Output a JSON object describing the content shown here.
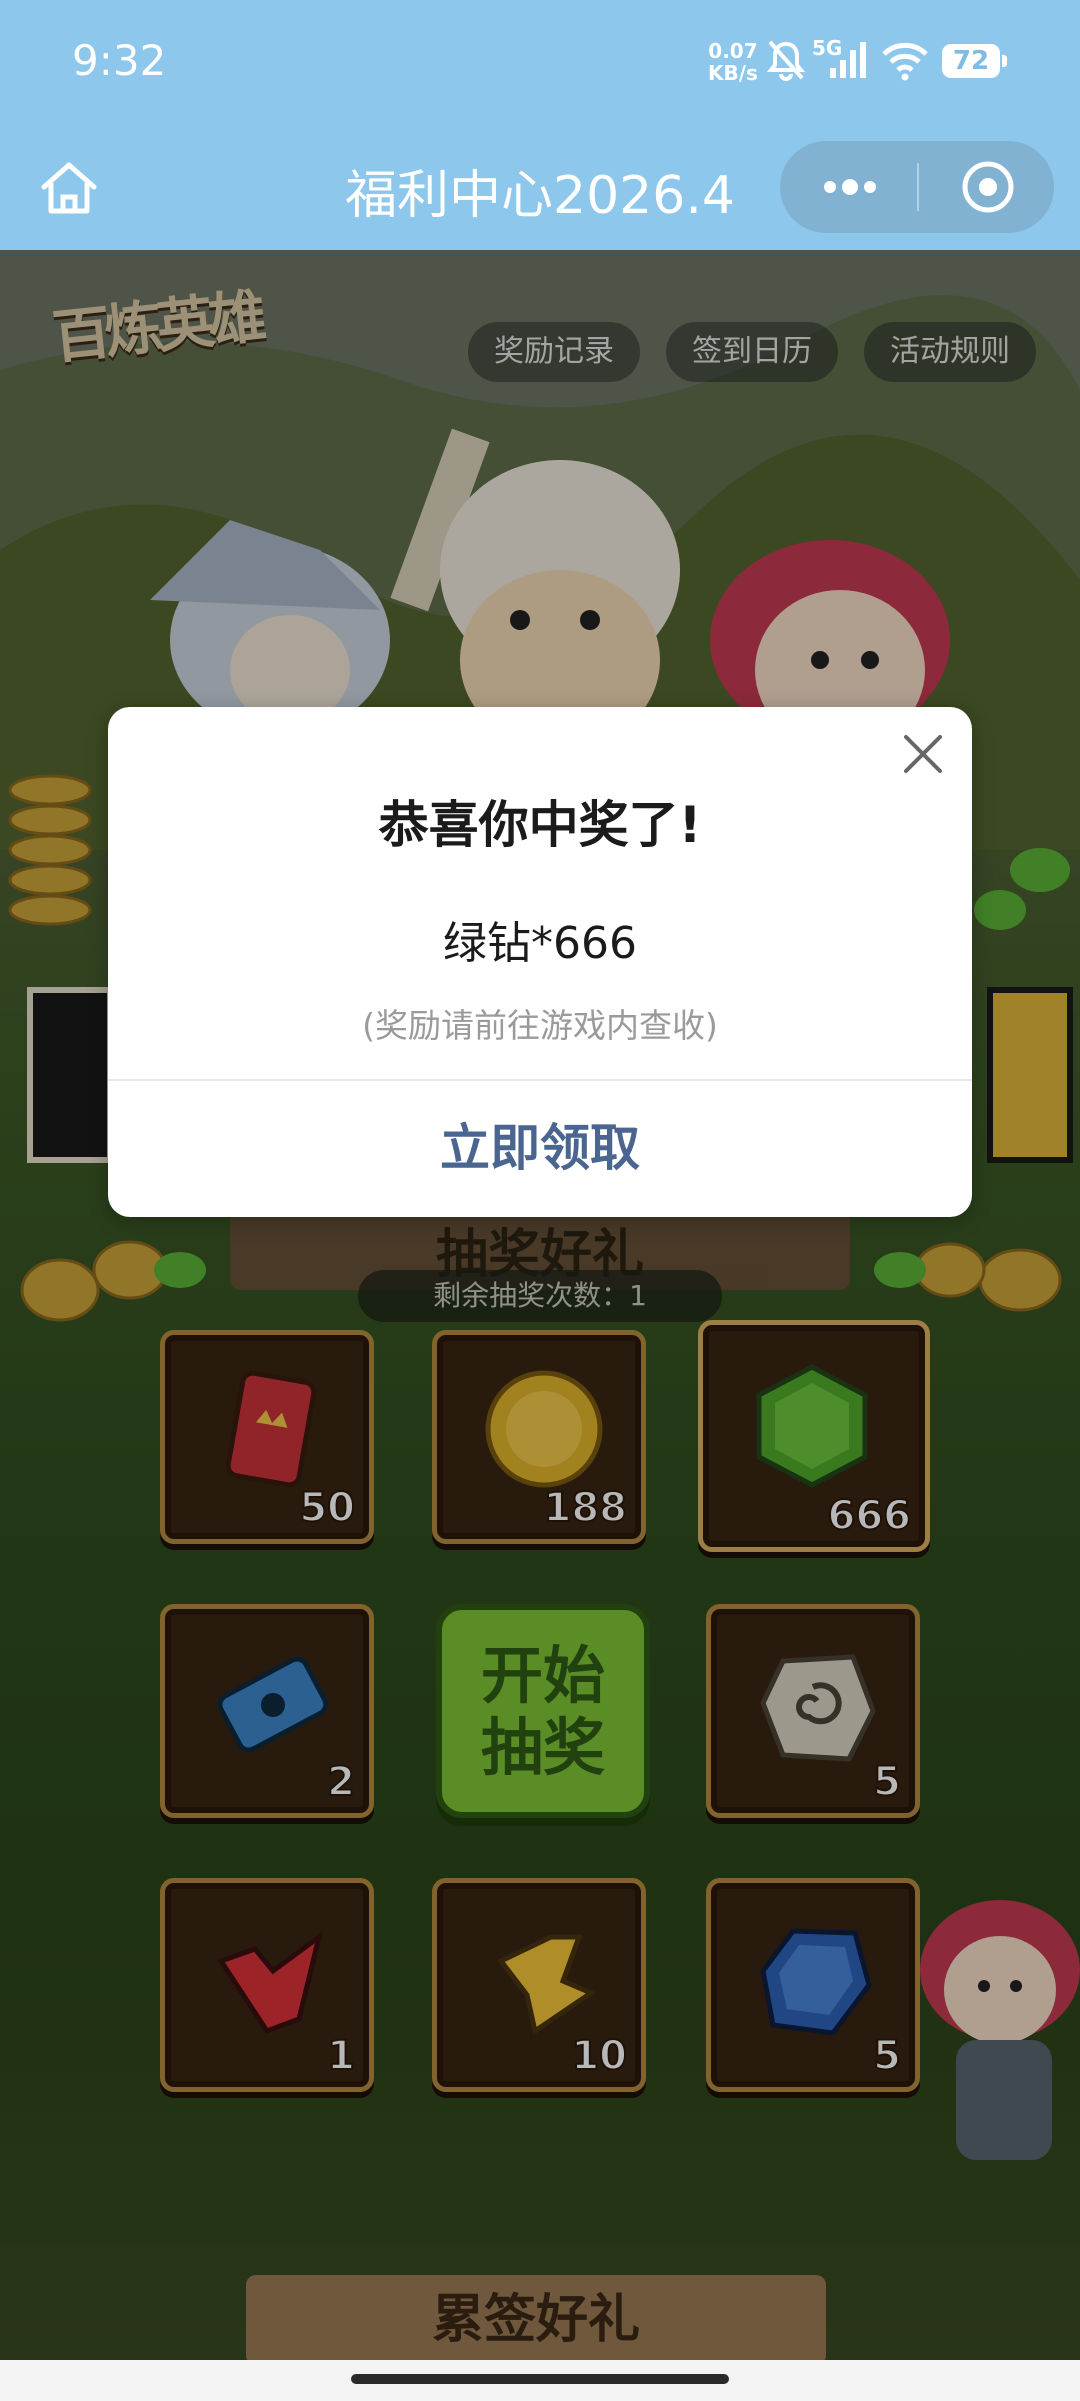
{
  "status_bar": {
    "time": "9:32",
    "net_speed_value": "0.07",
    "net_speed_unit": "KB/s",
    "network": "5G",
    "battery": "72"
  },
  "nav": {
    "title": "福利中心2026.4"
  },
  "game": {
    "logo": "百炼英雄",
    "top_buttons": [
      "奖励记录",
      "签到日历",
      "活动规则"
    ],
    "section_title": "抽奖好礼",
    "remaining_draws": "剩余抽奖次数：1",
    "start_button": [
      "开始",
      "抽奖"
    ],
    "prizes": [
      {
        "icon": "red-card-icon",
        "count": "50"
      },
      {
        "icon": "gold-coin-icon",
        "count": "188"
      },
      {
        "icon": "green-diamond-icon",
        "count": "666"
      },
      {
        "icon": "blue-ticket-icon",
        "count": "2"
      },
      {
        "icon": "stone-rune-icon",
        "count": "5"
      },
      {
        "icon": "red-crystal-icon",
        "count": "1"
      },
      {
        "icon": "yellow-crystal-icon",
        "count": "10"
      },
      {
        "icon": "blue-gem-icon",
        "count": "5"
      }
    ],
    "bottom_section_title": "累签好礼"
  },
  "modal": {
    "title": "恭喜你中奖了!",
    "prize": "绿钻*666",
    "hint": "(奖励请前往游戏内查收)",
    "action": "立即领取"
  },
  "colors": {
    "header": "#8dc7ec",
    "action_text": "#4a6590",
    "start_button": "#7ec437"
  }
}
